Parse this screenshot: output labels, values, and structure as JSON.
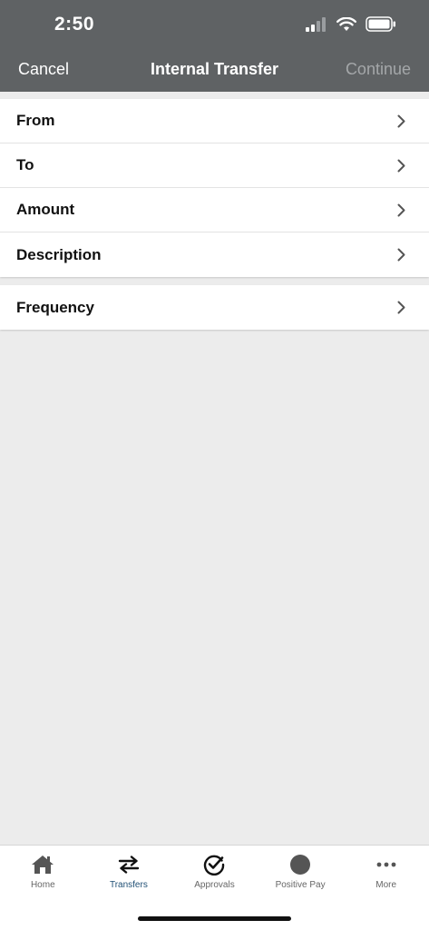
{
  "status_bar": {
    "time": "2:50"
  },
  "nav": {
    "cancel_label": "Cancel",
    "title": "Internal Transfer",
    "continue_label": "Continue"
  },
  "form": {
    "rows": [
      {
        "label": "From"
      },
      {
        "label": "To"
      },
      {
        "label": "Amount"
      },
      {
        "label": "Description"
      }
    ],
    "frequency": {
      "label": "Frequency"
    }
  },
  "tab_bar": {
    "tabs": [
      {
        "label": "Home",
        "icon": "home-icon"
      },
      {
        "label": "Transfers",
        "icon": "transfer-arrows-icon"
      },
      {
        "label": "Approvals",
        "icon": "check-circle-icon"
      },
      {
        "label": "Positive Pay",
        "icon": "circle-icon"
      },
      {
        "label": "More",
        "icon": "ellipsis-icon"
      }
    ],
    "active": "Transfers"
  },
  "colors": {
    "header_bg": "#5f6264",
    "active_tab": "#1f4f74",
    "content_bg": "#ececec"
  }
}
